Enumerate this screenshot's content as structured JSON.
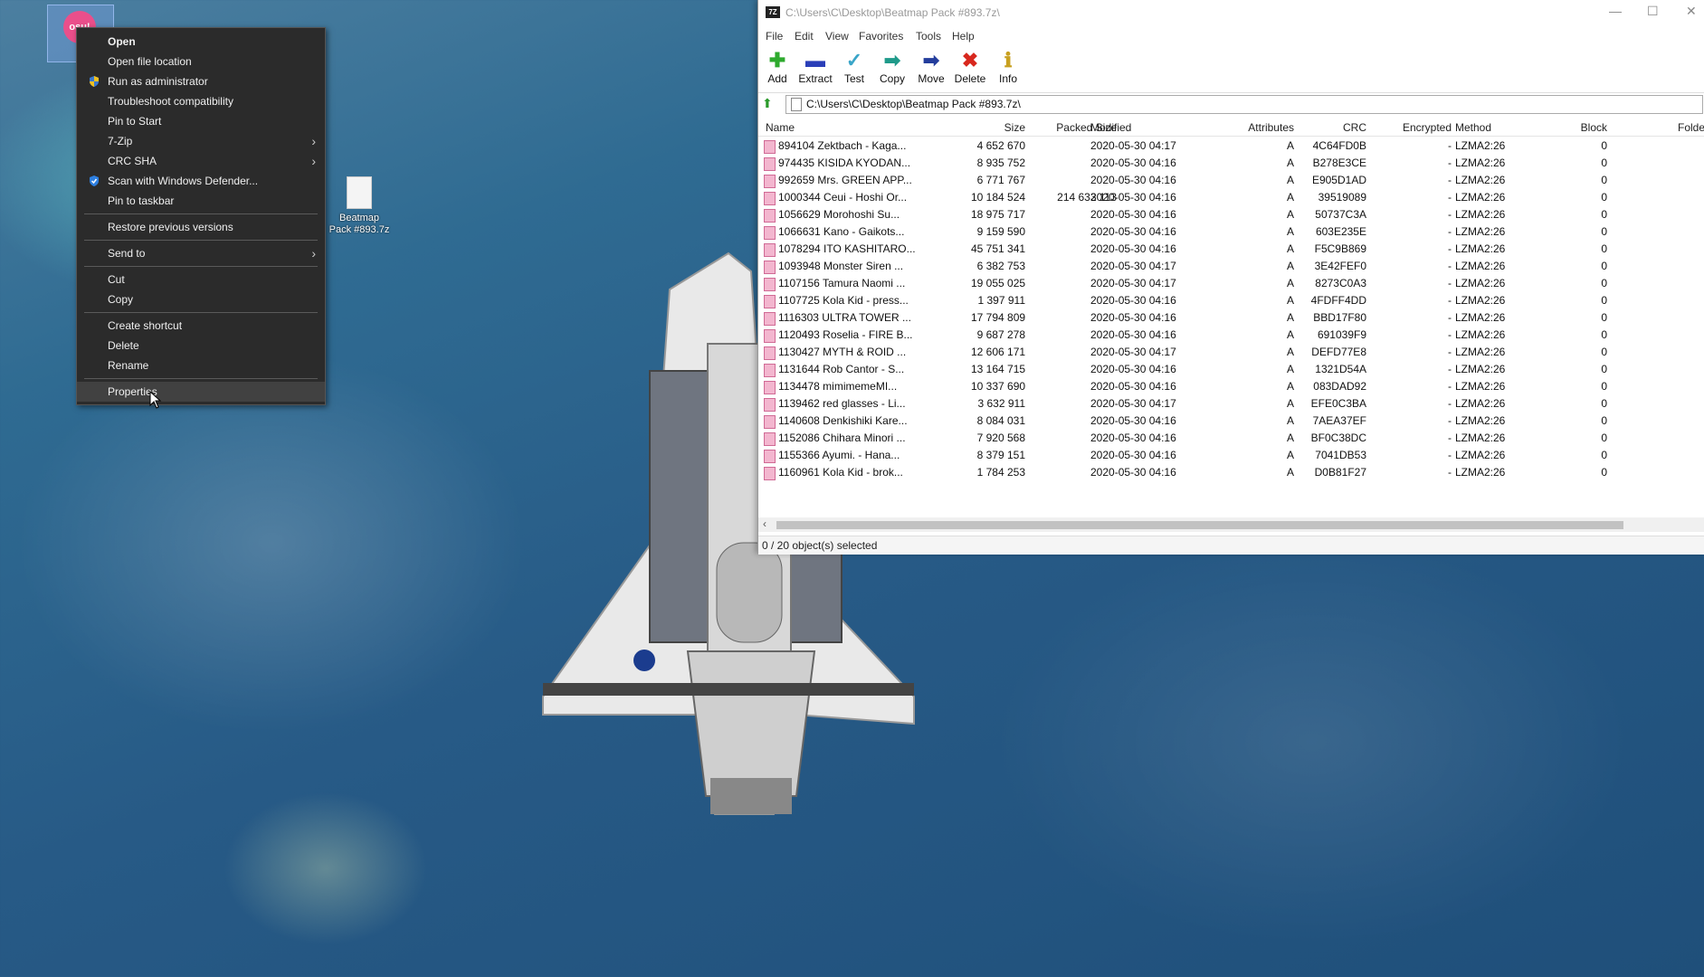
{
  "desktop": {
    "shortcut_label": "osu!",
    "file_icon_label_1": "Beatmap",
    "file_icon_label_2": "Pack #893.7z"
  },
  "context_menu": {
    "items": [
      {
        "label": "Open",
        "icon": "none",
        "submenu": false
      },
      {
        "label": "Open file location",
        "icon": "none",
        "submenu": false
      },
      {
        "label": "Run as administrator",
        "icon": "shield-icon",
        "submenu": false
      },
      {
        "label": "Troubleshoot compatibility",
        "icon": "none",
        "submenu": false
      },
      {
        "label": "Pin to Start",
        "icon": "none",
        "submenu": false
      },
      {
        "label": "7-Zip",
        "icon": "none",
        "submenu": true
      },
      {
        "label": "CRC SHA",
        "icon": "none",
        "submenu": true
      },
      {
        "label": "Scan with Windows Defender...",
        "icon": "defender-icon",
        "submenu": false
      },
      {
        "label": "Pin to taskbar",
        "icon": "none",
        "submenu": false
      },
      {
        "label": "Restore previous versions",
        "icon": "none",
        "submenu": false
      },
      {
        "label": "Send to",
        "icon": "none",
        "submenu": true
      },
      {
        "label": "Cut",
        "icon": "none",
        "submenu": false
      },
      {
        "label": "Copy",
        "icon": "none",
        "submenu": false
      },
      {
        "label": "Create shortcut",
        "icon": "none",
        "submenu": false
      },
      {
        "label": "Delete",
        "icon": "none",
        "submenu": false
      },
      {
        "label": "Rename",
        "icon": "none",
        "submenu": false
      },
      {
        "label": "Properties",
        "icon": "none",
        "submenu": false
      }
    ],
    "arrow_glyph": "›"
  },
  "zip_window": {
    "title": "C:\\Users\\C\\Desktop\\Beatmap Pack #893.7z\\",
    "app_icon_text": "7Z",
    "window_controls": {
      "minimize": "—",
      "maximize": "☐",
      "close": "✕"
    },
    "menu": [
      "File",
      "Edit",
      "View",
      "Favorites",
      "Tools",
      "Help"
    ],
    "toolbar": [
      {
        "label": "Add",
        "glyph": "✚",
        "color": "#2eaa2e"
      },
      {
        "label": "Extract",
        "glyph": "▬",
        "color": "#2a3fb8"
      },
      {
        "label": "Test",
        "glyph": "✓",
        "color": "#3aa5c8"
      },
      {
        "label": "Copy",
        "glyph": "➡",
        "color": "#1f9a8a"
      },
      {
        "label": "Move",
        "glyph": "➡",
        "color": "#233d9c"
      },
      {
        "label": "Delete",
        "glyph": "✖",
        "color": "#d8281e"
      },
      {
        "label": "Info",
        "glyph": "ℹ",
        "color": "#c8a020"
      }
    ],
    "address": "C:\\Users\\C\\Desktop\\Beatmap Pack #893.7z\\",
    "up_glyph": "⬆",
    "columns": [
      "Name",
      "Size",
      "Packed Size",
      "Modified",
      "Attributes",
      "CRC",
      "Encrypted",
      "Method",
      "Block",
      "Folders"
    ],
    "rows": [
      {
        "name": "894104 Zektbach - Kaga...",
        "size": "4 652 670",
        "packed": "",
        "modified": "2020-05-30 04:17",
        "attr": "A",
        "crc": "4C64FD0B",
        "enc": "-",
        "method": "LZMA2:26",
        "block": "0"
      },
      {
        "name": "974435 KISIDA KYODAN...",
        "size": "8 935 752",
        "packed": "",
        "modified": "2020-05-30 04:16",
        "attr": "A",
        "crc": "B278E3CE",
        "enc": "-",
        "method": "LZMA2:26",
        "block": "0"
      },
      {
        "name": "992659 Mrs. GREEN APP...",
        "size": "6 771 767",
        "packed": "",
        "modified": "2020-05-30 04:16",
        "attr": "A",
        "crc": "E905D1AD",
        "enc": "-",
        "method": "LZMA2:26",
        "block": "0"
      },
      {
        "name": "1000344 Ceui - Hoshi Or...",
        "size": "10 184 524",
        "packed": "214 633 113",
        "modified": "2020-05-30 04:16",
        "attr": "A",
        "crc": "39519089",
        "enc": "-",
        "method": "LZMA2:26",
        "block": "0"
      },
      {
        "name": "1056629 Morohoshi Su...",
        "size": "18 975 717",
        "packed": "",
        "modified": "2020-05-30 04:16",
        "attr": "A",
        "crc": "50737C3A",
        "enc": "-",
        "method": "LZMA2:26",
        "block": "0"
      },
      {
        "name": "1066631 Kano - Gaikots...",
        "size": "9 159 590",
        "packed": "",
        "modified": "2020-05-30 04:16",
        "attr": "A",
        "crc": "603E235E",
        "enc": "-",
        "method": "LZMA2:26",
        "block": "0"
      },
      {
        "name": "1078294 ITO KASHITARO...",
        "size": "45 751 341",
        "packed": "",
        "modified": "2020-05-30 04:16",
        "attr": "A",
        "crc": "F5C9B869",
        "enc": "-",
        "method": "LZMA2:26",
        "block": "0"
      },
      {
        "name": "1093948 Monster Siren ...",
        "size": "6 382 753",
        "packed": "",
        "modified": "2020-05-30 04:17",
        "attr": "A",
        "crc": "3E42FEF0",
        "enc": "-",
        "method": "LZMA2:26",
        "block": "0"
      },
      {
        "name": "1107156 Tamura Naomi ...",
        "size": "19 055 025",
        "packed": "",
        "modified": "2020-05-30 04:17",
        "attr": "A",
        "crc": "8273C0A3",
        "enc": "-",
        "method": "LZMA2:26",
        "block": "0"
      },
      {
        "name": "1107725 Kola Kid - press...",
        "size": "1 397 911",
        "packed": "",
        "modified": "2020-05-30 04:16",
        "attr": "A",
        "crc": "4FDFF4DD",
        "enc": "-",
        "method": "LZMA2:26",
        "block": "0"
      },
      {
        "name": "1116303 ULTRA TOWER ...",
        "size": "17 794 809",
        "packed": "",
        "modified": "2020-05-30 04:16",
        "attr": "A",
        "crc": "BBD17F80",
        "enc": "-",
        "method": "LZMA2:26",
        "block": "0"
      },
      {
        "name": "1120493 Roselia - FIRE B...",
        "size": "9 687 278",
        "packed": "",
        "modified": "2020-05-30 04:16",
        "attr": "A",
        "crc": "691039F9",
        "enc": "-",
        "method": "LZMA2:26",
        "block": "0"
      },
      {
        "name": "1130427 MYTH & ROID ...",
        "size": "12 606 171",
        "packed": "",
        "modified": "2020-05-30 04:17",
        "attr": "A",
        "crc": "DEFD77E8",
        "enc": "-",
        "method": "LZMA2:26",
        "block": "0"
      },
      {
        "name": "1131644 Rob Cantor - S...",
        "size": "13 164 715",
        "packed": "",
        "modified": "2020-05-30 04:16",
        "attr": "A",
        "crc": "1321D54A",
        "enc": "-",
        "method": "LZMA2:26",
        "block": "0"
      },
      {
        "name": "1134478 mimimemeMI...",
        "size": "10 337 690",
        "packed": "",
        "modified": "2020-05-30 04:16",
        "attr": "A",
        "crc": "083DAD92",
        "enc": "-",
        "method": "LZMA2:26",
        "block": "0"
      },
      {
        "name": "1139462 red glasses - Li...",
        "size": "3 632 911",
        "packed": "",
        "modified": "2020-05-30 04:17",
        "attr": "A",
        "crc": "EFE0C3BA",
        "enc": "-",
        "method": "LZMA2:26",
        "block": "0"
      },
      {
        "name": "1140608 Denkishiki Kare...",
        "size": "8 084 031",
        "packed": "",
        "modified": "2020-05-30 04:16",
        "attr": "A",
        "crc": "7AEA37EF",
        "enc": "-",
        "method": "LZMA2:26",
        "block": "0"
      },
      {
        "name": "1152086 Chihara Minori ...",
        "size": "7 920 568",
        "packed": "",
        "modified": "2020-05-30 04:16",
        "attr": "A",
        "crc": "BF0C38DC",
        "enc": "-",
        "method": "LZMA2:26",
        "block": "0"
      },
      {
        "name": "1155366 Ayumi. - Hana...",
        "size": "8 379 151",
        "packed": "",
        "modified": "2020-05-30 04:16",
        "attr": "A",
        "crc": "7041DB53",
        "enc": "-",
        "method": "LZMA2:26",
        "block": "0"
      },
      {
        "name": "1160961 Kola Kid - brok...",
        "size": "1 784 253",
        "packed": "",
        "modified": "2020-05-30 04:16",
        "attr": "A",
        "crc": "D0B81F27",
        "enc": "-",
        "method": "LZMA2:26",
        "block": "0"
      }
    ],
    "scroll_left_glyph": "‹",
    "status": "0 / 20 object(s) selected"
  }
}
